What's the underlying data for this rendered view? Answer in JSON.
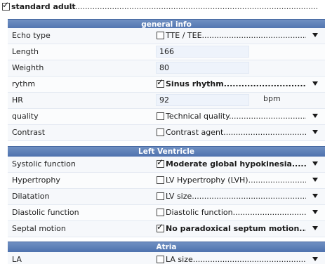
{
  "top": {
    "checked": true,
    "label": "standard adult",
    "dots": "..................................................................................................................................................................."
  },
  "sections": {
    "general": {
      "title": "general info",
      "echo_type": {
        "label": "Echo type",
        "checked": false,
        "value": "TTE / TEE.............................................................."
      },
      "length": {
        "label": "Length",
        "value": "166"
      },
      "weight": {
        "label": "Weighth",
        "value": "80"
      },
      "rythm": {
        "label": "rythm",
        "checked": true,
        "value": "Sinus rhythm................................................................"
      },
      "hr": {
        "label": "HR",
        "value": "92",
        "unit": "bpm"
      },
      "quality": {
        "label": "quality",
        "checked": false,
        "value": "Technical quality.................................................."
      },
      "contrast": {
        "label": "Contrast",
        "checked": false,
        "value": "Contrast agent......................................................"
      }
    },
    "lv": {
      "title": "Left Ventricle",
      "systolic": {
        "label": "Systolic function",
        "checked": true,
        "value": "Moderate global hypokinesia......................................"
      },
      "hypertrophy": {
        "label": "Hypertrophy",
        "checked": false,
        "value": "LV Hypertrophy (LVH)................................................"
      },
      "dilatation": {
        "label": "Dilatation",
        "checked": false,
        "value": "LV size....................................................................."
      },
      "diastolic": {
        "label": "Diastolic function",
        "checked": false,
        "value": "Diastolic function......................................................."
      },
      "septal": {
        "label": "Septal motion",
        "checked": true,
        "value": "No paradoxical septum motion....................................."
      }
    },
    "atria": {
      "title": "Atria",
      "la": {
        "label": "LA",
        "checked": false,
        "value": "LA size......................................................................"
      }
    }
  },
  "colors": {
    "header_bg": "#5677b0",
    "field_bg": "#eef3fb"
  },
  "icons": {
    "dropdown": "triangle-down",
    "check": "checkmark"
  }
}
